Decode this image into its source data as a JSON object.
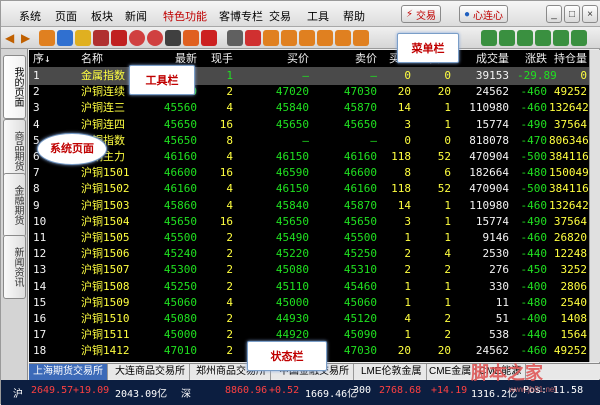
{
  "menu": [
    "系统",
    "页面",
    "板块",
    "新闻",
    "特色功能",
    "客博专栏",
    "交易",
    "工具",
    "帮助"
  ],
  "top_buttons": {
    "trade": "交易",
    "heart": "心连心"
  },
  "sidebar_tabs": [
    "我的页面",
    "商品期货",
    "金融期货",
    "新闻资讯"
  ],
  "columns": [
    "序↓",
    "名称",
    "最新",
    "现手",
    "买价",
    "卖价",
    "买量",
    "卖量",
    "成交量",
    "涨跌",
    "持仓量"
  ],
  "rows": [
    [
      "1",
      "金属指数",
      "",
      "1",
      "—",
      "—",
      "0",
      "0",
      "39153",
      "-29.89",
      "0"
    ],
    [
      "2",
      "沪铜连续",
      "47030",
      "2",
      "47020",
      "47030",
      "20",
      "20",
      "24562",
      "-460",
      "49252"
    ],
    [
      "3",
      "沪铜连三",
      "45560",
      "4",
      "45840",
      "45870",
      "14",
      "1",
      "110980",
      "-460",
      "132642"
    ],
    [
      "4",
      "沪铜连四",
      "45650",
      "16",
      "45650",
      "45650",
      "3",
      "1",
      "15774",
      "-490",
      "37564"
    ],
    [
      "5",
      "沪铜指数",
      "45650",
      "8",
      "—",
      "—",
      "0",
      "0",
      "818078",
      "-470",
      "806346"
    ],
    [
      "6",
      "沪铜主力",
      "46160",
      "4",
      "46150",
      "46160",
      "118",
      "52",
      "470904",
      "-500",
      "384116"
    ],
    [
      "7",
      "沪铜1501",
      "46600",
      "16",
      "46590",
      "46600",
      "8",
      "6",
      "182664",
      "-480",
      "150049"
    ],
    [
      "8",
      "沪铜1502",
      "46160",
      "4",
      "46150",
      "46160",
      "118",
      "52",
      "470904",
      "-500",
      "384116"
    ],
    [
      "9",
      "沪铜1503",
      "45860",
      "4",
      "45840",
      "45870",
      "14",
      "1",
      "110980",
      "-460",
      "132642"
    ],
    [
      "10",
      "沪铜1504",
      "45650",
      "16",
      "45650",
      "45650",
      "3",
      "1",
      "15774",
      "-490",
      "37564"
    ],
    [
      "11",
      "沪铜1505",
      "45500",
      "2",
      "45490",
      "45500",
      "1",
      "1",
      "9146",
      "-460",
      "26820"
    ],
    [
      "12",
      "沪铜1506",
      "45240",
      "2",
      "45220",
      "45250",
      "2",
      "4",
      "2530",
      "-440",
      "12248"
    ],
    [
      "13",
      "沪铜1507",
      "45300",
      "2",
      "45080",
      "45310",
      "2",
      "2",
      "276",
      "-450",
      "3252"
    ],
    [
      "14",
      "沪铜1508",
      "45250",
      "2",
      "45110",
      "45460",
      "1",
      "1",
      "330",
      "-400",
      "2806"
    ],
    [
      "15",
      "沪铜1509",
      "45060",
      "4",
      "45000",
      "45060",
      "1",
      "1",
      "11",
      "-480",
      "2540"
    ],
    [
      "16",
      "沪铜1510",
      "45080",
      "2",
      "44930",
      "45120",
      "4",
      "2",
      "51",
      "-400",
      "1408"
    ],
    [
      "17",
      "沪铜1511",
      "45000",
      "2",
      "44920",
      "45090",
      "1",
      "2",
      "538",
      "-440",
      "1564"
    ],
    [
      "18",
      "沪铜1412",
      "47010",
      "2",
      "47020",
      "47030",
      "20",
      "20",
      "24562",
      "-460",
      "49252"
    ]
  ],
  "exchanges": [
    "上海期货交易所",
    "大连商品交易所",
    "郑州商品交易所",
    "中国金融交易所",
    "LME伦敦金属",
    "CME金属",
    "CME能源"
  ],
  "status": [
    "沪",
    "2649.57",
    "+19.09",
    "2043.09亿",
    "深",
    "8860.96",
    "+0.52",
    "1669.46亿",
    "300",
    "2768.68",
    "+14.19",
    "1316.2亿",
    "Pos:",
    "11.58"
  ],
  "annotations": {
    "menubar": "菜单栏",
    "toolbar": "工具栏",
    "syspage": "系统页面",
    "statusbar": "状态栏"
  },
  "watermark": "脚本之家",
  "watermark_url": "www.jb51.net"
}
